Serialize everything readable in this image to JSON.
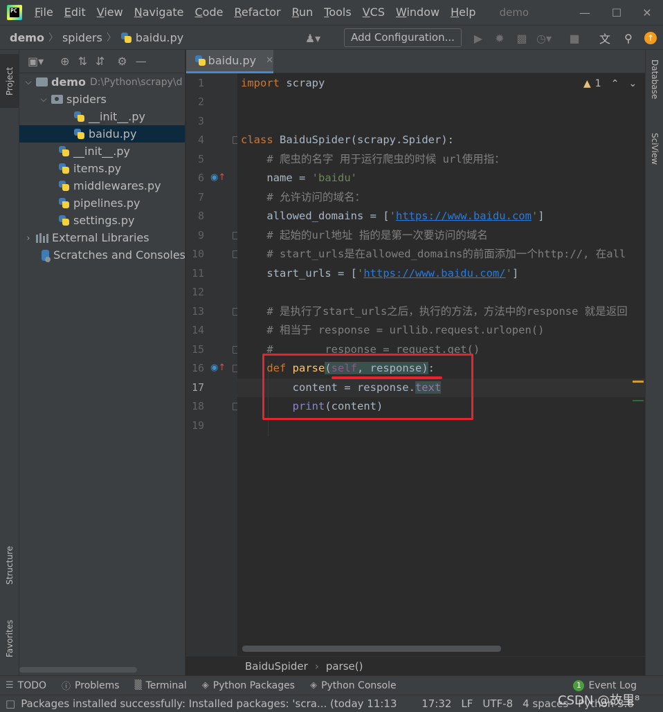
{
  "menubar": {
    "items": [
      "File",
      "Edit",
      "View",
      "Navigate",
      "Code",
      "Refactor",
      "Run",
      "Tools",
      "VCS",
      "Window",
      "Help"
    ],
    "window_title": "demo"
  },
  "navbar": {
    "crumbs": [
      "demo",
      "spiders",
      "baidu.py"
    ],
    "add_configuration": "Add Configuration..."
  },
  "left_stripe": {
    "project": "Project",
    "structure": "Structure",
    "favorites": "Favorites"
  },
  "right_stripe": {
    "database": "Database",
    "sciview": "SciView"
  },
  "project_tree": {
    "root": {
      "name": "demo",
      "path": "D:\\Python\\scrapy\\d"
    },
    "rows": [
      {
        "label": "spiders",
        "kind": "package"
      },
      {
        "label": "__init__.py",
        "kind": "py"
      },
      {
        "label": "baidu.py",
        "kind": "py",
        "selected": true
      },
      {
        "label": "__init__.py",
        "kind": "py"
      },
      {
        "label": "items.py",
        "kind": "py"
      },
      {
        "label": "middlewares.py",
        "kind": "py"
      },
      {
        "label": "pipelines.py",
        "kind": "py"
      },
      {
        "label": "settings.py",
        "kind": "py"
      },
      {
        "label": "External Libraries",
        "kind": "lib"
      },
      {
        "label": "Scratches and Consoles",
        "kind": "scratch"
      }
    ]
  },
  "editor": {
    "tab_label": "baidu.py",
    "warnings_count": "1",
    "line_numbers": [
      "1",
      "2",
      "3",
      "4",
      "5",
      "6",
      "7",
      "8",
      "9",
      "10",
      "11",
      "12",
      "13",
      "14",
      "15",
      "16",
      "17",
      "18",
      "19"
    ],
    "code": {
      "l1_kw": "import",
      "l1_rest": " scrapy",
      "l4_kw": "class",
      "l4_name": "BaiduSpider",
      "l4_rest": "(scrapy.Spider):",
      "l5": "    # 爬虫的名字 用于运行爬虫的时候 url使用指：",
      "l6_a": "    name = ",
      "l6_str": "'baidu'",
      "l7": "    # 允许访问的域名：",
      "l8_a": "    allowed_domains = [",
      "l8_q1": "'",
      "l8_url": "https://www.baidu.com",
      "l8_q2": "'",
      "l8_b": "]",
      "l9": "    # 起始的url地址 指的是第一次要访问的域名",
      "l10": "    # start_urls是在allowed_domains的前面添加一个http://, 在all",
      "l11_a": "    start_urls = [",
      "l11_q1": "'",
      "l11_url": "https://www.baidu.com/",
      "l11_q2": "'",
      "l11_b": "]",
      "l13": "    # 是执行了start_urls之后，执行的方法，方法中的response 就是返回",
      "l14": "    # 相当于 response = urllib.request.urlopen()",
      "l15": "    #        response = request.get()",
      "l16_kw": "    def ",
      "l16_name": "parse",
      "l16_p1": "(",
      "l16_self": "self",
      "l16_p2": ", response",
      "l16_p3": ")",
      "l16_colon": ":",
      "l17_a": "        content = response.",
      "l17_attr": "text",
      "l18_bi": "        print",
      "l18_rest": "(content)"
    }
  },
  "code_breadcrumb": [
    "BaiduSpider",
    "parse()"
  ],
  "toolwindows": [
    "TODO",
    "Problems",
    "Terminal",
    "Python Packages",
    "Python Console"
  ],
  "event_log": {
    "label": "Event Log",
    "count": "1"
  },
  "statusbar": {
    "message": "Packages installed successfully: Installed packages: 'scra... (today 11:13",
    "position": "17:32",
    "line_sep": "LF",
    "encoding": "UTF-8",
    "indent": "4 spaces",
    "interpreter": "Python 3.8"
  },
  "watermark": "CSDN @故里⁸",
  "colors": {
    "keyword": "#cc7832",
    "string": "#6a8759",
    "comment": "#808080",
    "function": "#ffc66d",
    "annotation_box": "#e8232d"
  }
}
